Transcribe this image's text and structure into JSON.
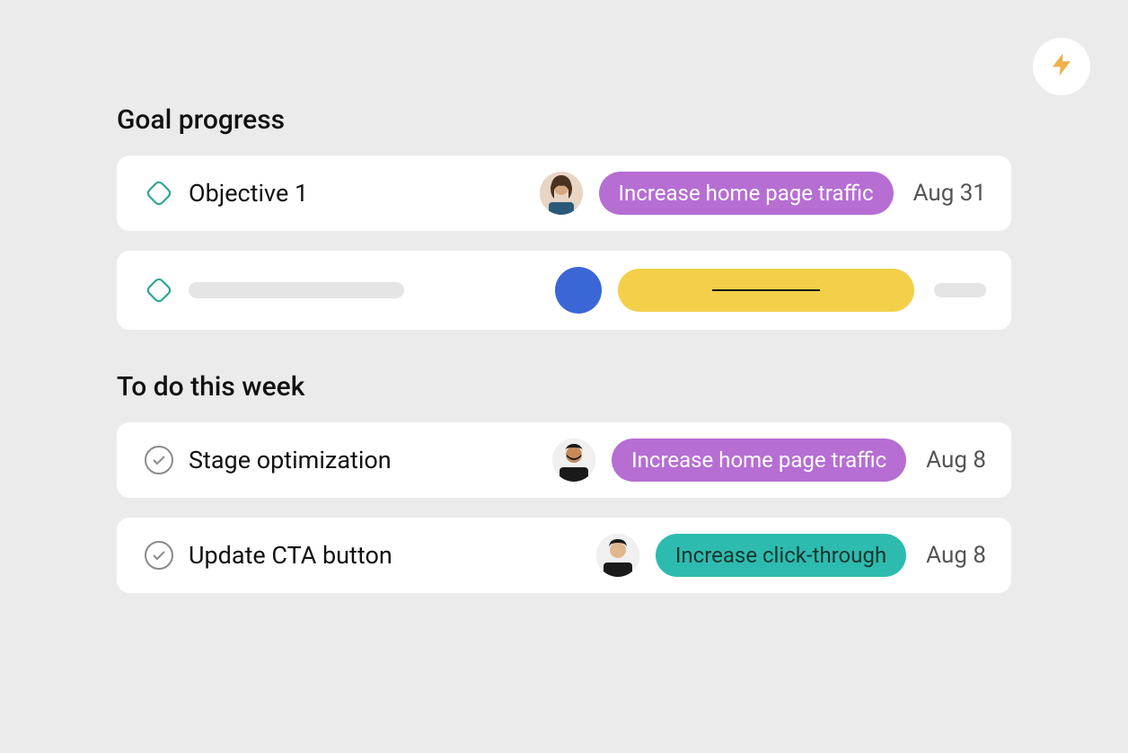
{
  "badge": {
    "icon": "lightning"
  },
  "sections": {
    "goals": {
      "title": "Goal progress",
      "items": [
        {
          "title": "Objective 1",
          "tag": "Increase home page traffic",
          "tag_color": "purple",
          "date": "Aug 31"
        }
      ]
    },
    "todo": {
      "title": "To do this week",
      "items": [
        {
          "title": "Stage optimization",
          "tag": "Increase home page traffic",
          "tag_color": "purple",
          "date": "Aug 8"
        },
        {
          "title": "Update CTA button",
          "tag": "Increase click-through",
          "tag_color": "teal",
          "date": "Aug 8"
        }
      ]
    }
  }
}
